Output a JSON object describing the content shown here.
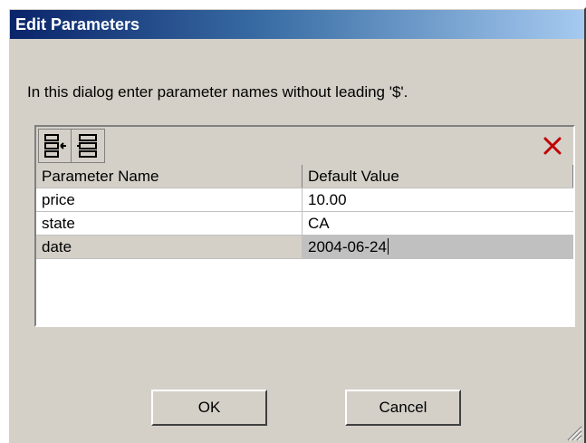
{
  "window": {
    "title": "Edit Parameters"
  },
  "instruction": "In this dialog enter parameter names without leading '$'.",
  "toolbar": {
    "buttons": [
      {
        "icon": "insert-row-icon"
      },
      {
        "icon": "append-row-icon"
      },
      {
        "icon": "delete-icon",
        "color": "#c00000"
      }
    ]
  },
  "table": {
    "headers": [
      "Parameter Name",
      "Default Value"
    ],
    "rows": [
      {
        "name": "price",
        "value": "10.00"
      },
      {
        "name": "state",
        "value": "CA"
      },
      {
        "name": "date",
        "value": "2004-06-24",
        "selected": true
      }
    ]
  },
  "buttons": {
    "ok_label": "OK",
    "cancel_label": "Cancel"
  }
}
